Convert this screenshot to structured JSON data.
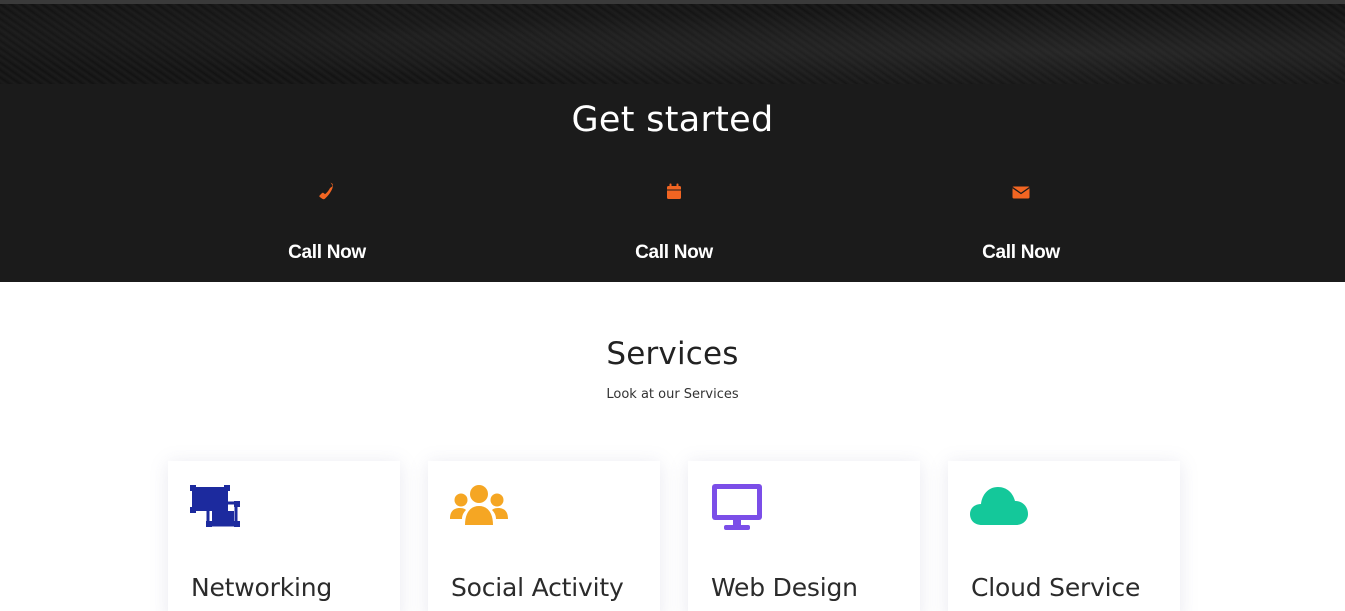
{
  "get_started": {
    "title": "Get started",
    "items": [
      {
        "label": "Call Now",
        "icon": "phone-icon"
      },
      {
        "label": "Call Now",
        "icon": "calendar-icon"
      },
      {
        "label": "Call Now",
        "icon": "envelope-icon"
      }
    ],
    "accent_color": "#f26522"
  },
  "services": {
    "title": "Services",
    "subtitle": "Look at our Services",
    "cards": [
      {
        "title": "Networking",
        "icon": "networking-icon",
        "color": "#1c2a9e"
      },
      {
        "title": "Social Activity",
        "icon": "users-icon",
        "color": "#f5a623"
      },
      {
        "title": "Web Design",
        "icon": "monitor-icon",
        "color": "#7b4ee8"
      },
      {
        "title": "Cloud Service",
        "icon": "cloud-icon",
        "color": "#14c89a"
      }
    ]
  }
}
